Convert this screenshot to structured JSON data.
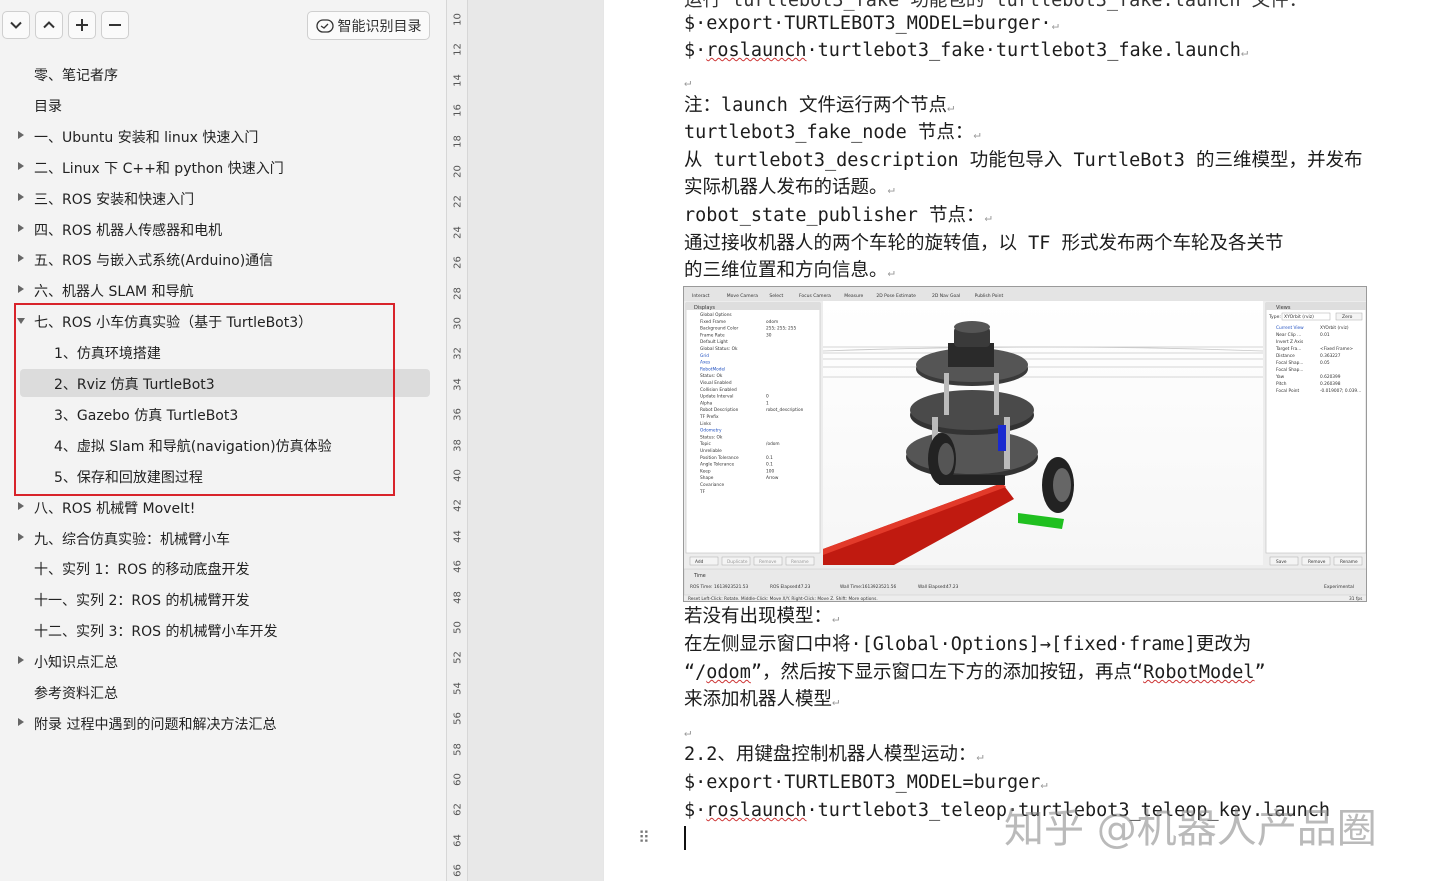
{
  "toolbar": {
    "smart_toc_label": "智能识别目录"
  },
  "toc": [
    {
      "label": "零、笔记者序",
      "level": 0,
      "arrow": "none"
    },
    {
      "label": "目录",
      "level": 0,
      "arrow": "none"
    },
    {
      "label": "一、Ubuntu 安装和 linux 快速入门",
      "level": 0,
      "arrow": "right"
    },
    {
      "label": "二、Linux 下 C++和 python 快速入门",
      "level": 0,
      "arrow": "right"
    },
    {
      "label": "三、ROS 安装和快速入门",
      "level": 0,
      "arrow": "right"
    },
    {
      "label": "四、ROS 机器人传感器和电机",
      "level": 0,
      "arrow": "right"
    },
    {
      "label": "五、ROS 与嵌入式系统(Arduino)通信",
      "level": 0,
      "arrow": "right"
    },
    {
      "label": "六、机器人 SLAM 和导航",
      "level": 0,
      "arrow": "right"
    },
    {
      "label": "七、ROS 小车仿真实验（基于 TurtleBot3）",
      "level": 0,
      "arrow": "down"
    },
    {
      "label": "1、仿真环境搭建",
      "level": 1,
      "arrow": "none"
    },
    {
      "label": "2、Rviz 仿真 TurtleBot3",
      "level": 1,
      "arrow": "none",
      "selected": true
    },
    {
      "label": "3、Gazebo 仿真 TurtleBot3",
      "level": 1,
      "arrow": "none"
    },
    {
      "label": "4、虚拟 Slam 和导航(navigation)仿真体验",
      "level": 1,
      "arrow": "none"
    },
    {
      "label": "5、保存和回放建图过程",
      "level": 1,
      "arrow": "none"
    },
    {
      "label": "八、ROS 机械臂 MoveIt!",
      "level": 0,
      "arrow": "right"
    },
    {
      "label": "九、综合仿真实验：机械臂小车",
      "level": 0,
      "arrow": "right"
    },
    {
      "label": "十、实列 1：ROS 的移动底盘开发",
      "level": 0,
      "arrow": "none"
    },
    {
      "label": "十一、实列 2：ROS 的机械臂开发",
      "level": 0,
      "arrow": "none"
    },
    {
      "label": "十二、实列 3：ROS 的机械臂小车开发",
      "level": 0,
      "arrow": "none"
    },
    {
      "label": "小知识点汇总",
      "level": 0,
      "arrow": "right"
    },
    {
      "label": "参考资料汇总",
      "level": 0,
      "arrow": "none"
    },
    {
      "label": "附录 过程中遇到的问题和解决方法汇总",
      "level": 0,
      "arrow": "right"
    }
  ],
  "ruler": [
    "10",
    "12",
    "14",
    "16",
    "18",
    "20",
    "22",
    "24",
    "26",
    "28",
    "30",
    "32",
    "34",
    "36",
    "38",
    "40",
    "42",
    "44",
    "46",
    "48",
    "50",
    "52",
    "54",
    "56",
    "58",
    "60",
    "62",
    "64",
    "66"
  ],
  "doc": {
    "l01": "$·export·TURTLEBOT3_MODEL=burger·",
    "l02a": "$·",
    "l02b": "roslaunch",
    "l02c": "·turtlebot3_fake·turtlebot3_fake.launch",
    "l03": "注：launch 文件运行两个节点",
    "l04": "turtlebot3_fake_node 节点：",
    "l05": "从 turtlebot3_description 功能包导入 TurtleBot3 的三维模型，并发布",
    "l06": "实际机器人发布的话题。",
    "l07": "robot_state_publisher 节点：",
    "l08": "通过接收机器人的两个车轮的旋转值，以 TF 形式发布两个车轮及各关节",
    "l09": "的三维位置和方向信息。",
    "l10": "若没有出现模型：",
    "l11": "在左侧显示窗口中将·[Global·Options]→[fixed·frame]更改为",
    "l12a": "“/",
    "l12b": "odom",
    "l12c": "”，然后按下显示窗口左下方的添加按钮，再点“",
    "l12d": "RobotModel",
    "l12e": "”",
    "l13": "来添加机器人模型",
    "l14": "2.2、用键盘控制机器人模型运动：",
    "l15": "$·export·TURTLEBOT3_MODEL=burger",
    "l16a": "$·",
    "l16b": "roslaunch",
    "l16c": "·turtlebot3_teleop·turtlebot3_teleop_key.launch",
    "para": "↵"
  },
  "watermark": "知乎 @机器人产品圈",
  "rviz": {
    "toolbar": [
      "Interact",
      "Move Camera",
      "Select",
      "Focus Camera",
      "Measure",
      "2D Pose Estimate",
      "2D Nav Goal",
      "Publish Point"
    ],
    "displays_title": "Displays",
    "displays": [
      [
        "Global Options",
        ""
      ],
      [
        "Fixed Frame",
        "odom"
      ],
      [
        "Background Color",
        "255; 255; 255"
      ],
      [
        "Frame Rate",
        "30"
      ],
      [
        "Default Light",
        ""
      ],
      [
        "Global Status: Ok",
        ""
      ],
      [
        "Grid",
        ""
      ],
      [
        "Axes",
        ""
      ],
      [
        "RobotModel",
        ""
      ],
      [
        "Status: Ok",
        ""
      ],
      [
        "Visual Enabled",
        ""
      ],
      [
        "Collision Enabled",
        ""
      ],
      [
        "Update Interval",
        "0"
      ],
      [
        "Alpha",
        "1"
      ],
      [
        "Robot Description",
        "robot_description"
      ],
      [
        "TF Prefix",
        ""
      ],
      [
        "Links",
        ""
      ],
      [
        "Odometry",
        ""
      ],
      [
        "Status: Ok",
        ""
      ],
      [
        "Topic",
        "/odom"
      ],
      [
        "Unreliable",
        ""
      ],
      [
        "Position Tolerance",
        "0.1"
      ],
      [
        "Angle Tolerance",
        "0.1"
      ],
      [
        "Keep",
        "100"
      ],
      [
        "Shape",
        "Arrow"
      ],
      [
        "Covariance",
        ""
      ],
      [
        "TF",
        ""
      ]
    ],
    "buttons_left": [
      "Add",
      "Duplicate",
      "Remove",
      "Rename"
    ],
    "views_title": "Views",
    "views_type_label": "Type:",
    "views_type": "XYOrbit (rviz)",
    "views_zero": "Zero",
    "views": [
      [
        "Current View",
        "XYOrbit (rviz)"
      ],
      [
        "Near Clip ...",
        "0.01"
      ],
      [
        "Invert Z Axis",
        ""
      ],
      [
        "Target Fra...",
        "<Fixed Frame>"
      ],
      [
        "Distance",
        "0.363227"
      ],
      [
        "Focal Shap...",
        "0.05"
      ],
      [
        "Focal Shap...",
        ""
      ],
      [
        "Yaw",
        "0.620399"
      ],
      [
        "Pitch",
        "0.260398"
      ],
      [
        "Focal Point",
        "-0.019007; 0.039..."
      ]
    ],
    "buttons_right": [
      "Save",
      "Remove",
      "Rename"
    ],
    "time_title": "Time",
    "time_row": [
      "ROS Time:",
      "1613923521.53",
      "ROS Elapsed:",
      "47.23",
      "Wall Time:",
      "1613923521.56",
      "Wall Elapsed:",
      "47.23"
    ],
    "experimental": "Experimental",
    "status": "Reset  Left-Click: Rotate. Middle-Click: Move X/Y. Right-Click: Move Z. Shift: More options.",
    "fps": "31 fps"
  }
}
